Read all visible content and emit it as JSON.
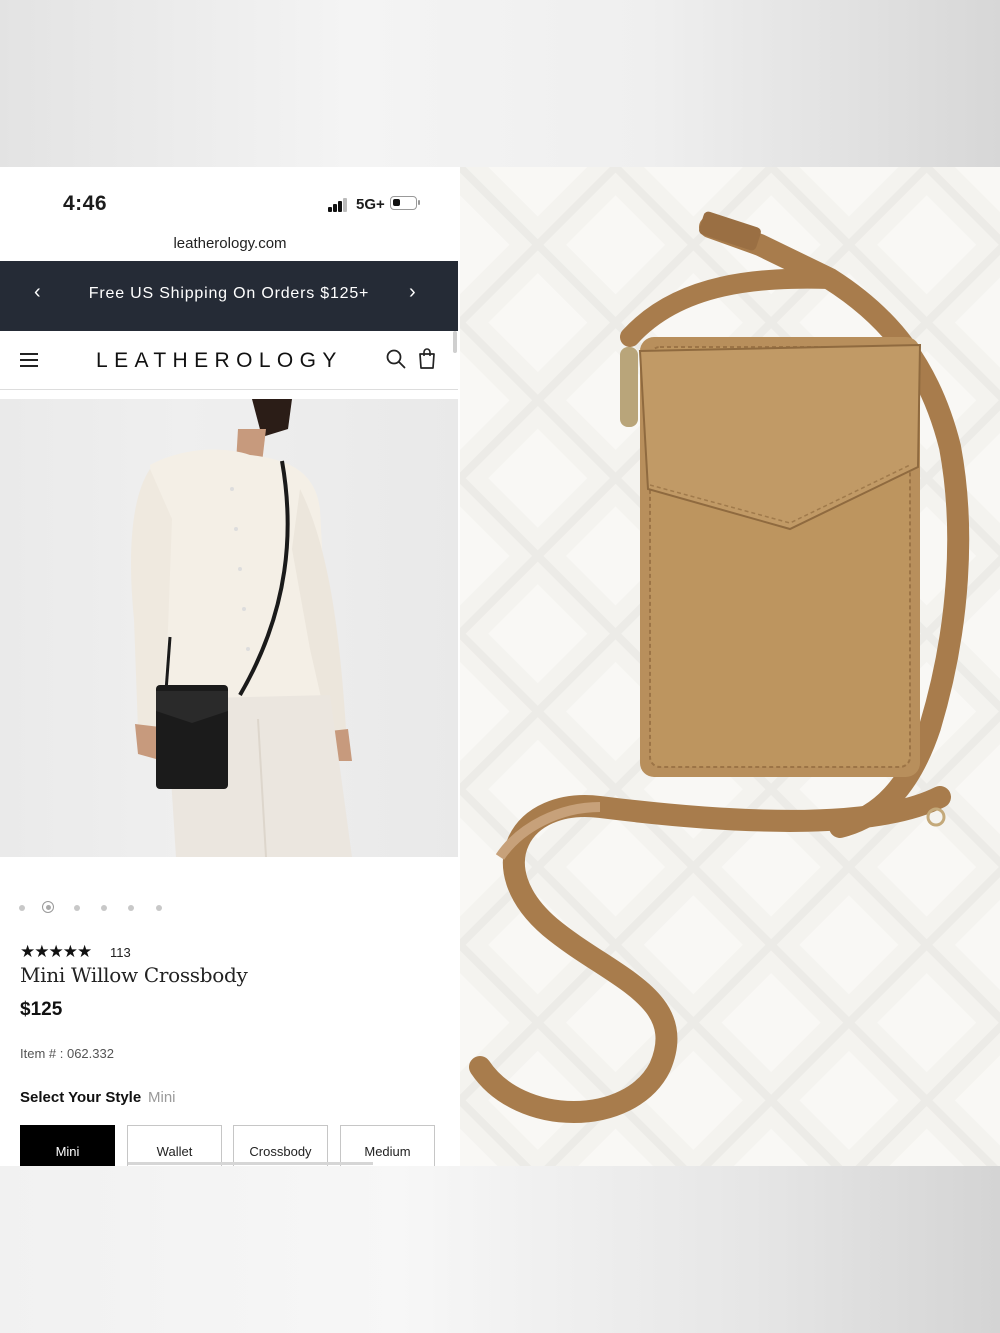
{
  "status_bar": {
    "time": "4:46",
    "network": "5G+"
  },
  "browser": {
    "url": "leatherology.com"
  },
  "promo": {
    "prev_icon": "chevron-left-icon",
    "text": "Free US Shipping On Orders $125+",
    "next_icon": "chevron-right-icon"
  },
  "header": {
    "logo": "LEATHEROLOGY",
    "menu_icon": "hamburger-menu-icon",
    "search_icon": "search-icon",
    "cart_icon": "shopping-bag-icon"
  },
  "gallery": {
    "image_count": 6,
    "active_index": 1
  },
  "product": {
    "stars": "★★★★★",
    "rating_value": 5,
    "review_count": "113",
    "name": "Mini Willow Crossbody",
    "price": "$125",
    "item_number": "Item # : 062.332",
    "style_label": "Select Your Style",
    "style_selected": "Mini",
    "style_options": [
      "Mini",
      "Wallet",
      "Crossbody",
      "Medium"
    ]
  },
  "colors": {
    "promo_bg": "#252b36",
    "selected_option_bg": "#000000",
    "bag_tan": "#b88f5c"
  }
}
